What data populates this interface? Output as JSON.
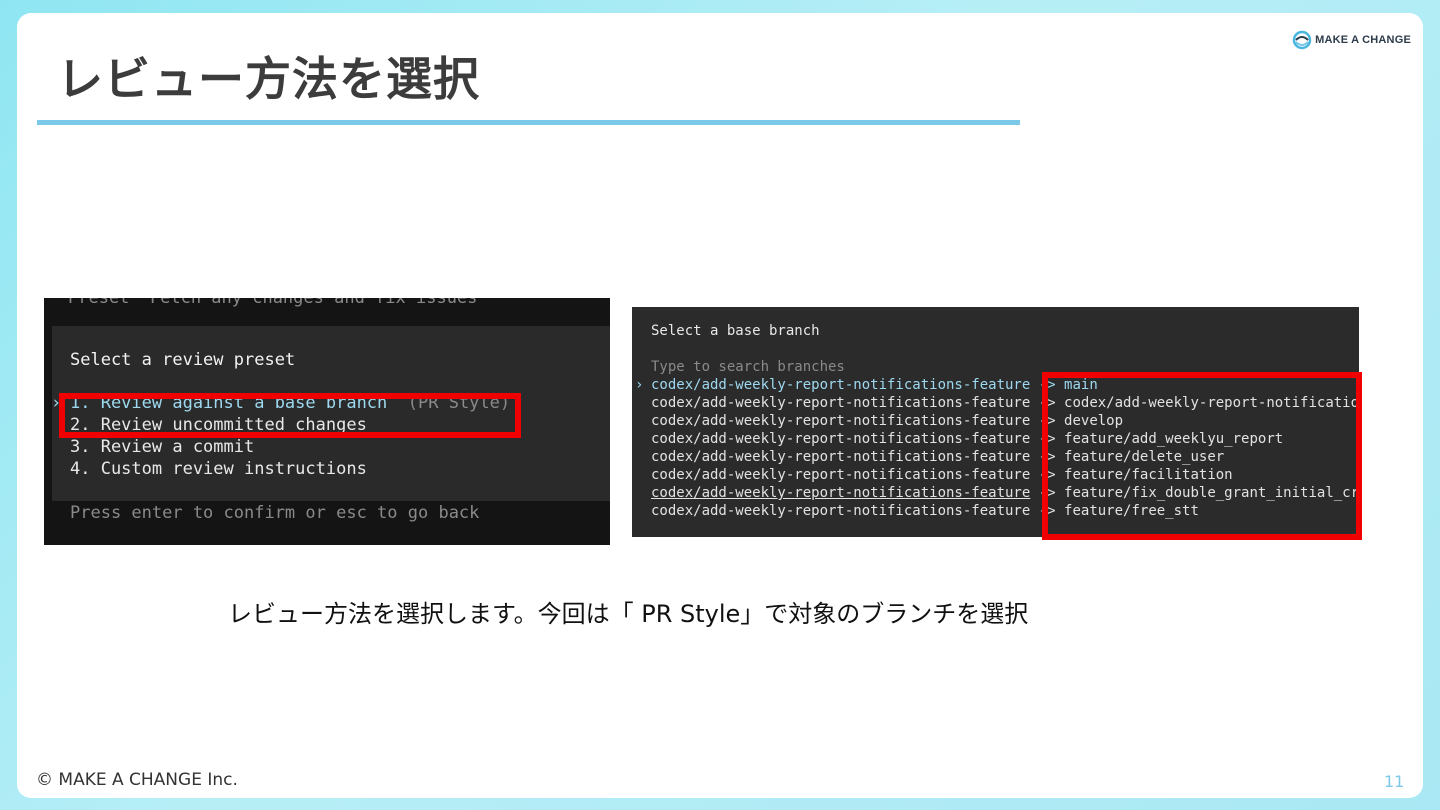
{
  "slide": {
    "title": "レビュー方法を選択",
    "logo_text": "MAKE A CHANGE",
    "logo_icon": "make-a-change-logo-icon",
    "caption": "レビュー方法を選択します。今回は「 PR Style」で対象のブランチを選択",
    "copyright": "© MAKE A CHANGE Inc.",
    "page_number": "11",
    "accent_color": "#7cc8e8",
    "highlight_color": "#f00000"
  },
  "preset_terminal": {
    "cut_line": "Preset  Fetch any changes and fix issues",
    "heading": "Select a review preset",
    "caret": "›",
    "options": [
      {
        "label": "1. Review against a base branch",
        "suffix": "(PR Style)"
      },
      {
        "label": "2. Review uncommitted changes"
      },
      {
        "label": "3. Review a commit"
      },
      {
        "label": "4. Custom review instructions"
      }
    ],
    "footer": "Press enter to confirm or esc to go back"
  },
  "branch_terminal": {
    "heading": "Select a base branch",
    "placeholder": "Type to search branches",
    "caret": "›",
    "source_branch": "codex/add-weekly-report-notifications-feature",
    "arrow": "->",
    "targets": [
      "main",
      "codex/add-weekly-report-notifications-feature",
      "develop",
      "feature/add_weeklyu_report",
      "feature/delete_user",
      "feature/facilitation",
      "feature/fix_double_grant_initial_credits",
      "feature/free_stt"
    ]
  }
}
